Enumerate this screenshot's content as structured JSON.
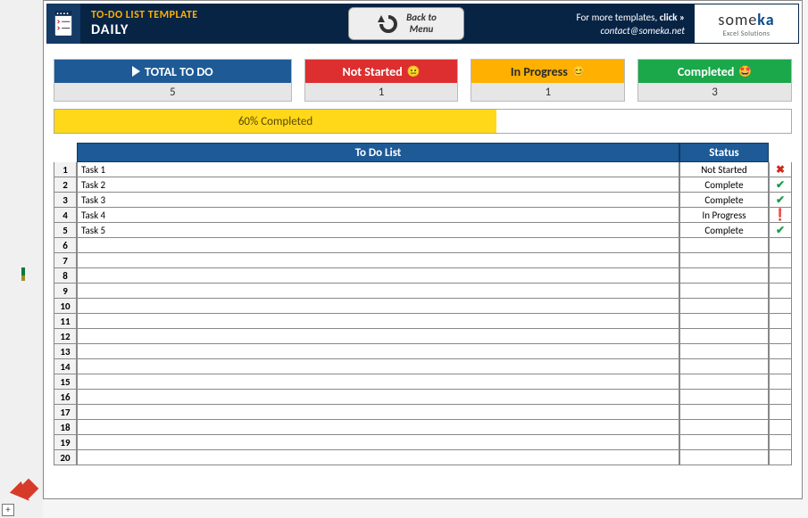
{
  "header": {
    "template_label": "TO-DO LIST TEMPLATE",
    "mode": "DAILY",
    "back_l1": "Back to",
    "back_l2": "Menu",
    "more_pre": "For more templates, ",
    "more_act": "click »",
    "email": "contact@someka.net",
    "logo_a": "some",
    "logo_b": "ka",
    "logo_sub": "Excel Solutions"
  },
  "stats": {
    "total": {
      "label": "TOTAL TO DO",
      "value": "5"
    },
    "notstarted": {
      "label": "Not Started",
      "value": "1"
    },
    "inprogress": {
      "label": "In Progress",
      "value": "1"
    },
    "completed": {
      "label": "Completed",
      "value": "3"
    }
  },
  "progress": {
    "pct": "60",
    "text": "60% Completed"
  },
  "columns": {
    "task": "To Do List",
    "status": "Status"
  },
  "rows": [
    {
      "n": "1",
      "task": "Task 1",
      "status": "Not Started",
      "icon": "x"
    },
    {
      "n": "2",
      "task": "Task 2",
      "status": "Complete",
      "icon": "check"
    },
    {
      "n": "3",
      "task": "Task 3",
      "status": "Complete",
      "icon": "check"
    },
    {
      "n": "4",
      "task": "Task 4",
      "status": "In Progress",
      "icon": "excl"
    },
    {
      "n": "5",
      "task": "Task 5",
      "status": "Complete",
      "icon": "check"
    },
    {
      "n": "6",
      "task": "",
      "status": "",
      "icon": ""
    },
    {
      "n": "7",
      "task": "",
      "status": "",
      "icon": ""
    },
    {
      "n": "8",
      "task": "",
      "status": "",
      "icon": ""
    },
    {
      "n": "9",
      "task": "",
      "status": "",
      "icon": ""
    },
    {
      "n": "10",
      "task": "",
      "status": "",
      "icon": ""
    },
    {
      "n": "11",
      "task": "",
      "status": "",
      "icon": ""
    },
    {
      "n": "12",
      "task": "",
      "status": "",
      "icon": ""
    },
    {
      "n": "13",
      "task": "",
      "status": "",
      "icon": ""
    },
    {
      "n": "14",
      "task": "",
      "status": "",
      "icon": ""
    },
    {
      "n": "15",
      "task": "",
      "status": "",
      "icon": ""
    },
    {
      "n": "16",
      "task": "",
      "status": "",
      "icon": ""
    },
    {
      "n": "17",
      "task": "",
      "status": "",
      "icon": ""
    },
    {
      "n": "18",
      "task": "",
      "status": "",
      "icon": ""
    },
    {
      "n": "19",
      "task": "",
      "status": "",
      "icon": ""
    },
    {
      "n": "20",
      "task": "",
      "status": "",
      "icon": ""
    }
  ]
}
